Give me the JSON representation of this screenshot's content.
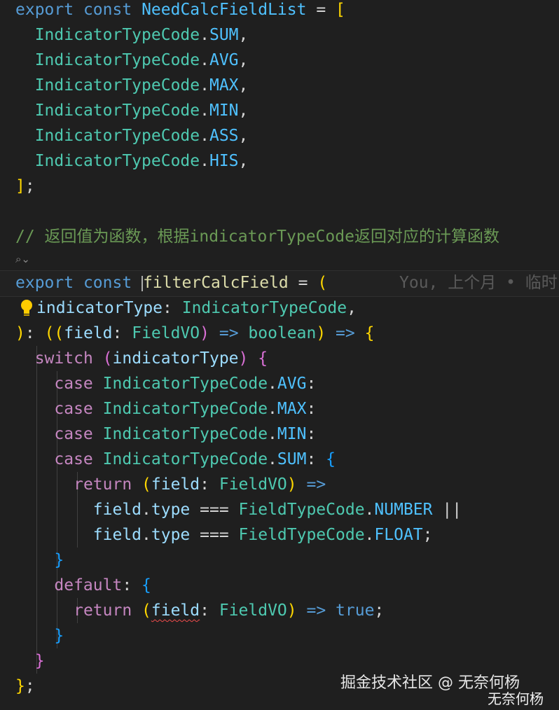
{
  "code": {
    "l1": {
      "t1": "export",
      "t2": "const",
      "t3": "NeedCalcFieldList",
      "t4": " = ",
      "t5": "["
    },
    "l2": {
      "cls": "IndicatorTypeCode",
      "dot": ".",
      "mem": "SUM",
      "end": ","
    },
    "l3": {
      "cls": "IndicatorTypeCode",
      "dot": ".",
      "mem": "AVG",
      "end": ","
    },
    "l4": {
      "cls": "IndicatorTypeCode",
      "dot": ".",
      "mem": "MAX",
      "end": ","
    },
    "l5": {
      "cls": "IndicatorTypeCode",
      "dot": ".",
      "mem": "MIN",
      "end": ","
    },
    "l6": {
      "cls": "IndicatorTypeCode",
      "dot": ".",
      "mem": "ASS",
      "end": ","
    },
    "l7": {
      "cls": "IndicatorTypeCode",
      "dot": ".",
      "mem": "HIS",
      "end": ","
    },
    "l8": {
      "t1": "]",
      "t2": ";"
    },
    "comment": "// 返回值为函数，根据indicatorTypeCode返回对应的计算函数",
    "codelens": "⌕⌄",
    "l10": {
      "t1": "export",
      "t2": "const",
      "t3": "filterCalcField",
      "t4": " = ",
      "t5": "("
    },
    "blame": "You, 上个月 • 临时",
    "l11": {
      "t1": "indicatorType",
      "t2": ": ",
      "t3": "IndicatorTypeCode",
      "t4": ","
    },
    "l12": {
      "t1": ")",
      "t2": ": ",
      "t3": "((",
      "t4": "field",
      "t5": ": ",
      "t6": "FieldVO",
      "t7": ")",
      "t8": " => ",
      "t9": "boolean",
      "t10": ")",
      "t11": " => ",
      "t12": "{"
    },
    "l13": {
      "t1": "switch",
      "t2": " (",
      "t3": "indicatorType",
      "t4": ")",
      "t5": " {"
    },
    "l14": {
      "kw": "case",
      "cls": "IndicatorTypeCode",
      "dot": ".",
      "mem": "AVG",
      "end": ":"
    },
    "l15": {
      "kw": "case",
      "cls": "IndicatorTypeCode",
      "dot": ".",
      "mem": "MAX",
      "end": ":"
    },
    "l16": {
      "kw": "case",
      "cls": "IndicatorTypeCode",
      "dot": ".",
      "mem": "MIN",
      "end": ":"
    },
    "l17": {
      "kw": "case",
      "cls": "IndicatorTypeCode",
      "dot": ".",
      "mem": "SUM",
      "end": ": ",
      "br": "{"
    },
    "l18": {
      "t1": "return",
      "t2": " (",
      "t3": "field",
      "t4": ": ",
      "t5": "FieldVO",
      "t6": ")",
      "t7": " =>"
    },
    "l19": {
      "t1": "field",
      "t2": ".",
      "t3": "type",
      "t4": " === ",
      "t5": "FieldTypeCode",
      "t6": ".",
      "t7": "NUMBER",
      "t8": " ||"
    },
    "l20": {
      "t1": "field",
      "t2": ".",
      "t3": "type",
      "t4": " === ",
      "t5": "FieldTypeCode",
      "t6": ".",
      "t7": "FLOAT",
      "t8": ";"
    },
    "l21": {
      "t1": "}"
    },
    "l22": {
      "t1": "default",
      "t2": ": ",
      "t3": "{"
    },
    "l23": {
      "t1": "return",
      "t2": " (",
      "t3": "field",
      "t4": ": ",
      "t5": "FieldVO",
      "t6": ")",
      "t7": " => ",
      "t8": "true",
      "t9": ";"
    },
    "l24": {
      "t1": "}"
    },
    "l25": {
      "t1": "}"
    },
    "l26": {
      "t1": "}",
      "t2": ";"
    }
  },
  "watermark": {
    "line1": "掘金技术社区 @ 无奈何杨",
    "line2": "无奈何杨"
  },
  "colors": {
    "background": "#1f1f1f",
    "keyword": "#569cd6",
    "control": "#c586c0",
    "type": "#4ec9b0",
    "enum_member": "#4fc1ff",
    "function": "#dcdcaa",
    "variable": "#9cdcfe",
    "comment": "#6a9955",
    "bracket_gold": "#ffd700",
    "bracket_purple": "#da70d6",
    "bracket_blue": "#179fff",
    "error": "#f14c4c"
  },
  "icons": [
    "lightbulb-icon",
    "codelens-icon"
  ]
}
